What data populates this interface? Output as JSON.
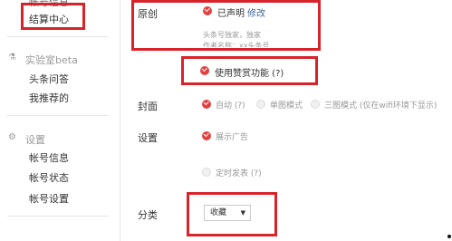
{
  "sidebar": {
    "cut_item": "帐号信息",
    "settlement": "结算中心",
    "lab_header": "实验室beta",
    "lab_items": [
      "头条问答",
      "我推荐的"
    ],
    "settings_header": "设置",
    "settings_items": [
      "帐号信息",
      "帐号状态",
      "帐号设置"
    ]
  },
  "form": {
    "original": {
      "label": "原创",
      "status": "已声明",
      "edit": "修改",
      "sub_1": "头条号独家，独家",
      "sub_2": "作者名称：xx头条号"
    },
    "reward": {
      "label": "使用赞赏功能 (?)"
    },
    "cover": {
      "label": "封面",
      "options": [
        {
          "label": "自动 (?)",
          "selected": true
        },
        {
          "label": "单图模式",
          "selected": false
        },
        {
          "label": "三图模式 (仅在wifi环境下显示)",
          "selected": false
        }
      ]
    },
    "settings": {
      "label": "设置",
      "ad": "展示广告"
    },
    "schedule": {
      "label": "定时发表 (?)"
    },
    "category": {
      "label": "分类",
      "value": "收藏"
    }
  },
  "colors": {
    "highlight": "#d8232a",
    "accent": "#e54040",
    "link": "#406599"
  }
}
